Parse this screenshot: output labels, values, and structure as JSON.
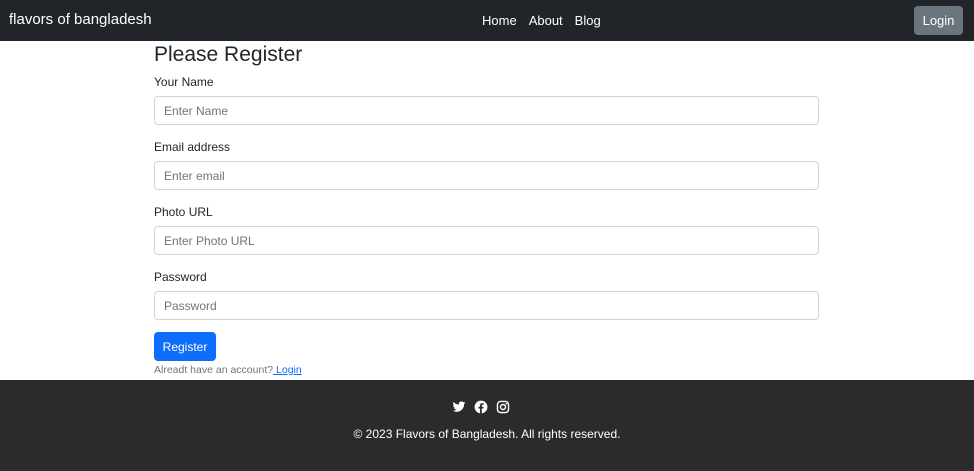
{
  "navbar": {
    "brand": "flavors of bangladesh",
    "links": [
      {
        "label": "Home"
      },
      {
        "label": "About"
      },
      {
        "label": "Blog"
      }
    ],
    "login_label": "Login"
  },
  "form": {
    "title": "Please Register",
    "fields": [
      {
        "label": "Your Name",
        "placeholder": "Enter Name"
      },
      {
        "label": "Email address",
        "placeholder": "Enter email"
      },
      {
        "label": "Photo URL",
        "placeholder": "Enter Photo URL"
      },
      {
        "label": "Password",
        "placeholder": "Password"
      }
    ],
    "register_label": "Register",
    "account_text": "Alreadt have an account?",
    "login_link": " Login"
  },
  "footer": {
    "icons": [
      "twitter-icon",
      "facebook-icon",
      "instagram-icon"
    ],
    "copyright": "© 2023 Flavors of Bangladesh. All rights reserved."
  },
  "colors": {
    "navbar_bg": "#212529",
    "login_button": "#6c757d",
    "register_button": "#0d6efd",
    "footer_bg": "#2b2b2b"
  }
}
